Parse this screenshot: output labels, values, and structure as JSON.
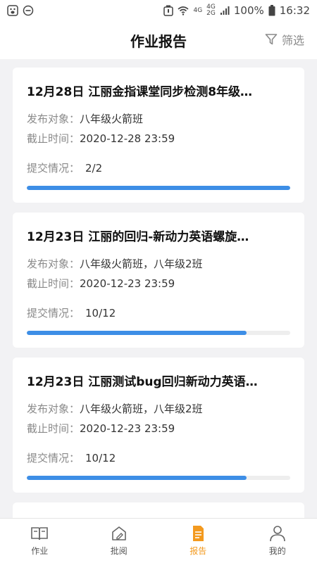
{
  "status_bar": {
    "net_top": "4G",
    "net_bottom": "2G",
    "net2_top": "4G",
    "battery_text": "100%",
    "time": "16:32"
  },
  "header": {
    "title": "作业报告",
    "filter_label": "筛选"
  },
  "labels": {
    "target": "发布对象：",
    "deadline": "截止时间：",
    "submit": "提交情况："
  },
  "cards": [
    {
      "title": "12月28日 江丽金指课堂同步检测8年级…",
      "target": "八年级火箭班",
      "deadline": "2020-12-28 23:59",
      "submit": "2/2",
      "progress": 1.0
    },
    {
      "title": "12月23日 江丽的回归-新动力英语螺旋…",
      "target": "八年级火箭班，八年级2班",
      "deadline": "2020-12-23 23:59",
      "submit": "10/12",
      "progress": 0.833
    },
    {
      "title": "12月23日 江丽测试bug回归新动力英语…",
      "target": "八年级火箭班，八年级2班",
      "deadline": "2020-12-23 23:59",
      "submit": "10/12",
      "progress": 0.833
    }
  ],
  "tabs": [
    {
      "label": "作业",
      "icon": "book-icon",
      "active": false
    },
    {
      "label": "批阅",
      "icon": "review-icon",
      "active": false
    },
    {
      "label": "报告",
      "icon": "report-icon",
      "active": true
    },
    {
      "label": "我的",
      "icon": "user-icon",
      "active": false
    }
  ],
  "colors": {
    "accent": "#f39a1f",
    "progress": "#3d8ee6"
  }
}
